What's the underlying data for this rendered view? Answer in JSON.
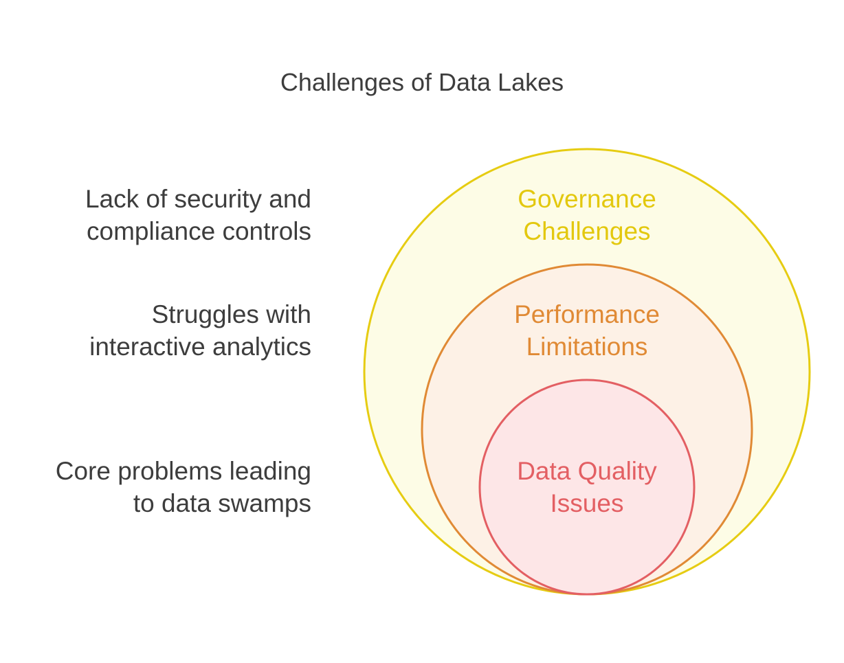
{
  "title": "Challenges of Data Lakes",
  "colors": {
    "governance_stroke": "#e6cc12",
    "governance_fill": "#fdfce6",
    "governance_text": "#e3c80e",
    "performance_stroke": "#e08a35",
    "performance_fill": "#fdf1e6",
    "performance_text": "#e08a35",
    "quality_stroke": "#e35f63",
    "quality_fill": "#fde6e7",
    "quality_text": "#e35f63",
    "text": "#3d3d3d"
  },
  "levels": [
    {
      "name_lines": [
        "Governance",
        "Challenges"
      ],
      "description_lines": [
        "Lack of security and",
        "compliance controls"
      ]
    },
    {
      "name_lines": [
        "Performance",
        "Limitations"
      ],
      "description_lines": [
        "Struggles with",
        "interactive analytics"
      ]
    },
    {
      "name_lines": [
        "Data Quality",
        "Issues"
      ],
      "description_lines": [
        "Core problems leading",
        "to data swamps"
      ]
    }
  ]
}
